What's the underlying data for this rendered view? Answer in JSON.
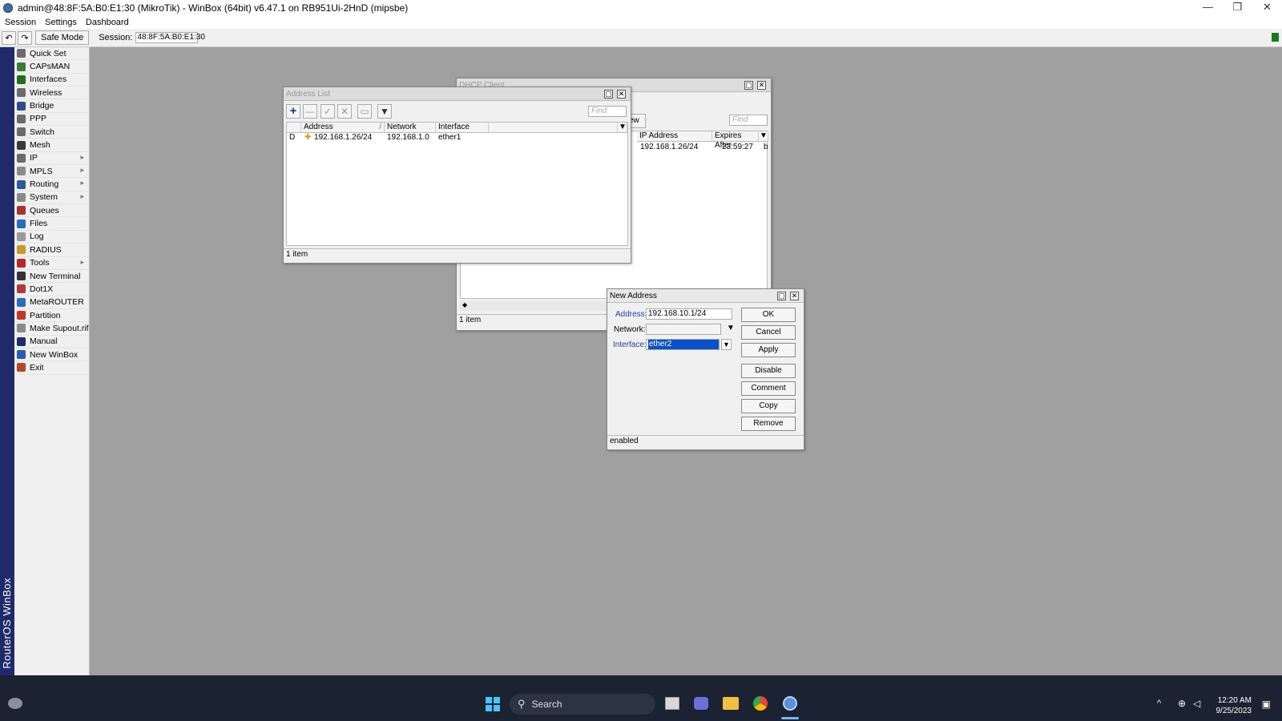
{
  "window": {
    "title": "admin@48:8F:5A:B0:E1:30 (MikroTik) - WinBox (64bit) v6.47.1 on RB951Ui-2HnD (mipsbe)",
    "controls": [
      "—",
      "❐",
      "✕"
    ]
  },
  "menubar": {
    "items": [
      "Session",
      "Settings",
      "Dashboard"
    ]
  },
  "toolbar": {
    "undo_icon": "↶",
    "redo_icon": "↷",
    "safe_mode": "Safe Mode",
    "session_label": "Session:",
    "session_value": "48:8F:5A:B0:E1:30"
  },
  "brand": "RouterOS WinBox",
  "sidebar": {
    "items": [
      {
        "label": "Quick Set",
        "icon": "wand-icon",
        "color": "#6b6b6b",
        "arrow": false
      },
      {
        "label": "CAPsMAN",
        "icon": "capsman-icon",
        "color": "#3a7a3a",
        "arrow": false
      },
      {
        "label": "Interfaces",
        "icon": "interfaces-icon",
        "color": "#1e6e1e",
        "arrow": false
      },
      {
        "label": "Wireless",
        "icon": "wireless-icon",
        "color": "#6b6b6b",
        "arrow": false
      },
      {
        "label": "Bridge",
        "icon": "bridge-icon",
        "color": "#2b4b8b",
        "arrow": false
      },
      {
        "label": "PPP",
        "icon": "ppp-icon",
        "color": "#6b6b6b",
        "arrow": false
      },
      {
        "label": "Switch",
        "icon": "switch-icon",
        "color": "#6b6b6b",
        "arrow": false
      },
      {
        "label": "Mesh",
        "icon": "mesh-icon",
        "color": "#3b3b3b",
        "arrow": false
      },
      {
        "label": "IP",
        "icon": "ip-icon",
        "color": "#6b6b6b",
        "arrow": true
      },
      {
        "label": "MPLS",
        "icon": "mpls-icon",
        "color": "#8a8a8a",
        "arrow": true
      },
      {
        "label": "Routing",
        "icon": "routing-icon",
        "color": "#2b5b9b",
        "arrow": true
      },
      {
        "label": "System",
        "icon": "system-icon",
        "color": "#8a8a8a",
        "arrow": true
      },
      {
        "label": "Queues",
        "icon": "queues-icon",
        "color": "#a83232",
        "arrow": false
      },
      {
        "label": "Files",
        "icon": "files-icon",
        "color": "#2b6bbb",
        "arrow": false
      },
      {
        "label": "Log",
        "icon": "log-icon",
        "color": "#9a9a9a",
        "arrow": false
      },
      {
        "label": "RADIUS",
        "icon": "radius-icon",
        "color": "#c89a2b",
        "arrow": false
      },
      {
        "label": "Tools",
        "icon": "tools-icon",
        "color": "#b02a2a",
        "arrow": true
      },
      {
        "label": "New Terminal",
        "icon": "terminal-icon",
        "color": "#333333",
        "arrow": false
      },
      {
        "label": "Dot1X",
        "icon": "dot1x-icon",
        "color": "#b03a3a",
        "arrow": false
      },
      {
        "label": "MetaROUTER",
        "icon": "metarouter-icon",
        "color": "#2b6bbb",
        "arrow": false
      },
      {
        "label": "Partition",
        "icon": "partition-icon",
        "color": "#c03a2a",
        "arrow": false
      },
      {
        "label": "Make Supout.rif",
        "icon": "supout-icon",
        "color": "#8a8a8a",
        "arrow": false
      },
      {
        "label": "Manual",
        "icon": "manual-icon",
        "color": "#1f2a6b",
        "arrow": false
      },
      {
        "label": "New WinBox",
        "icon": "winbox-icon",
        "color": "#2b5bab",
        "arrow": false
      },
      {
        "label": "Exit",
        "icon": "exit-icon",
        "color": "#b04a2a",
        "arrow": false
      }
    ]
  },
  "dhcp_window": {
    "title": "DHCP Client",
    "button_fragment": "ew",
    "find_placeholder": "Find",
    "columns": [
      "IP Address",
      "Expires After"
    ],
    "row": {
      "ip": "192.168.1.26/24",
      "expires": "23:59:27"
    },
    "trailing_fragment": "b",
    "scroll_arrow": "◆",
    "status": "1 item"
  },
  "address_list": {
    "title": "Address List",
    "find_placeholder": "Find",
    "tools": {
      "add": "+",
      "remove": "—",
      "enable": "✓",
      "disable": "✕",
      "comment": "▭",
      "filter": "▼"
    },
    "columns": {
      "address": "Address",
      "network": "Network",
      "interface": "Interface"
    },
    "rows": [
      {
        "flag": "D",
        "address": "192.168.1.26/24",
        "network": "192.168.1.0",
        "interface": "ether1"
      }
    ],
    "status": "1 item"
  },
  "new_address": {
    "title": "New Address",
    "address_label": "Address:",
    "address_value": "192.168.10.1/24",
    "network_label": "Network:",
    "network_value": "",
    "interface_label": "Interface:",
    "interface_value": "ether2",
    "buttons": {
      "ok": "OK",
      "cancel": "Cancel",
      "apply": "Apply",
      "disable": "Disable",
      "comment": "Comment",
      "copy": "Copy",
      "remove": "Remove"
    },
    "status": "enabled"
  },
  "taskbar": {
    "search": "Search",
    "time": "12:20 AM",
    "date": "9/25/2023"
  }
}
